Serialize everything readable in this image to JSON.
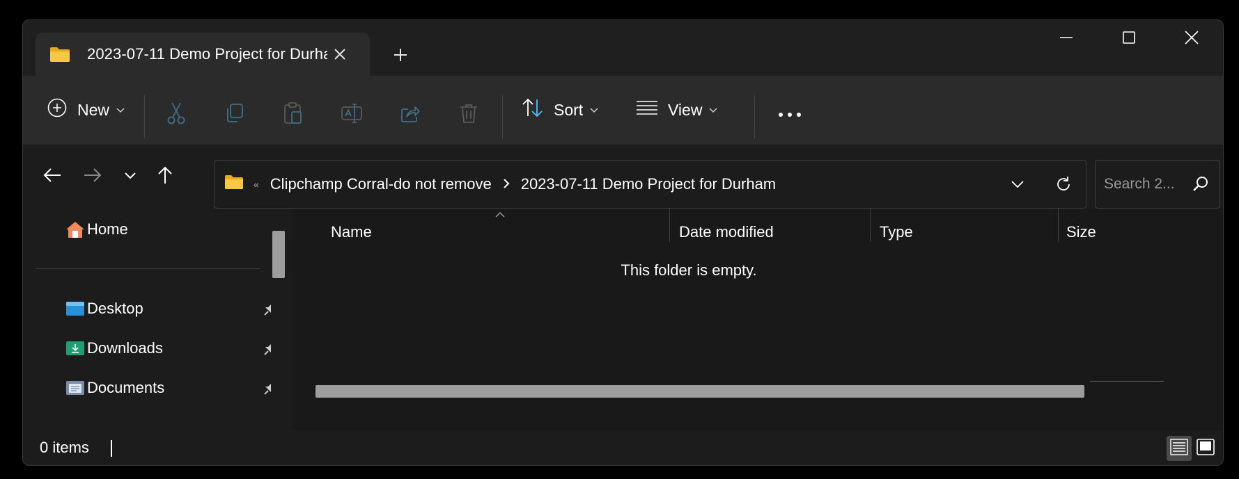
{
  "tab": {
    "title": "2023-07-11 Demo Project for Durham",
    "icon": "folder-icon"
  },
  "window_controls": [
    "minimize-icon",
    "maximize-icon",
    "close-icon"
  ],
  "toolbar": {
    "new_label": "New",
    "sort_label": "Sort",
    "view_label": "View",
    "icons": [
      "plus-circle-icon",
      "cut-icon",
      "copy-icon",
      "paste-icon",
      "rename-icon",
      "share-icon",
      "delete-icon",
      "sort-icon",
      "view-icon",
      "more-icon"
    ]
  },
  "address": {
    "crumbs": [
      "Clipchamp Corral-do not remove",
      "2023-07-11 Demo Project for Durham"
    ],
    "overflow_glyph": "«"
  },
  "search": {
    "placeholder": "Search 2..."
  },
  "sidebar": {
    "home": "Home",
    "items": [
      {
        "label": "Desktop",
        "icon": "desktop-folder-icon",
        "pinned": true
      },
      {
        "label": "Downloads",
        "icon": "downloads-folder-icon",
        "pinned": true
      },
      {
        "label": "Documents",
        "icon": "documents-folder-icon",
        "pinned": true
      }
    ]
  },
  "columns": {
    "name": "Name",
    "date_modified": "Date modified",
    "type": "Type",
    "size": "Size"
  },
  "content": {
    "empty_message": "This folder is empty."
  },
  "status": {
    "item_count": "0 items"
  },
  "colors": {
    "folder_yellow": "#f3c13a",
    "accent_blue": "#4cc2ff",
    "window_bg": "#1c1c1c",
    "toolbar_bg": "#2b2b2b"
  }
}
